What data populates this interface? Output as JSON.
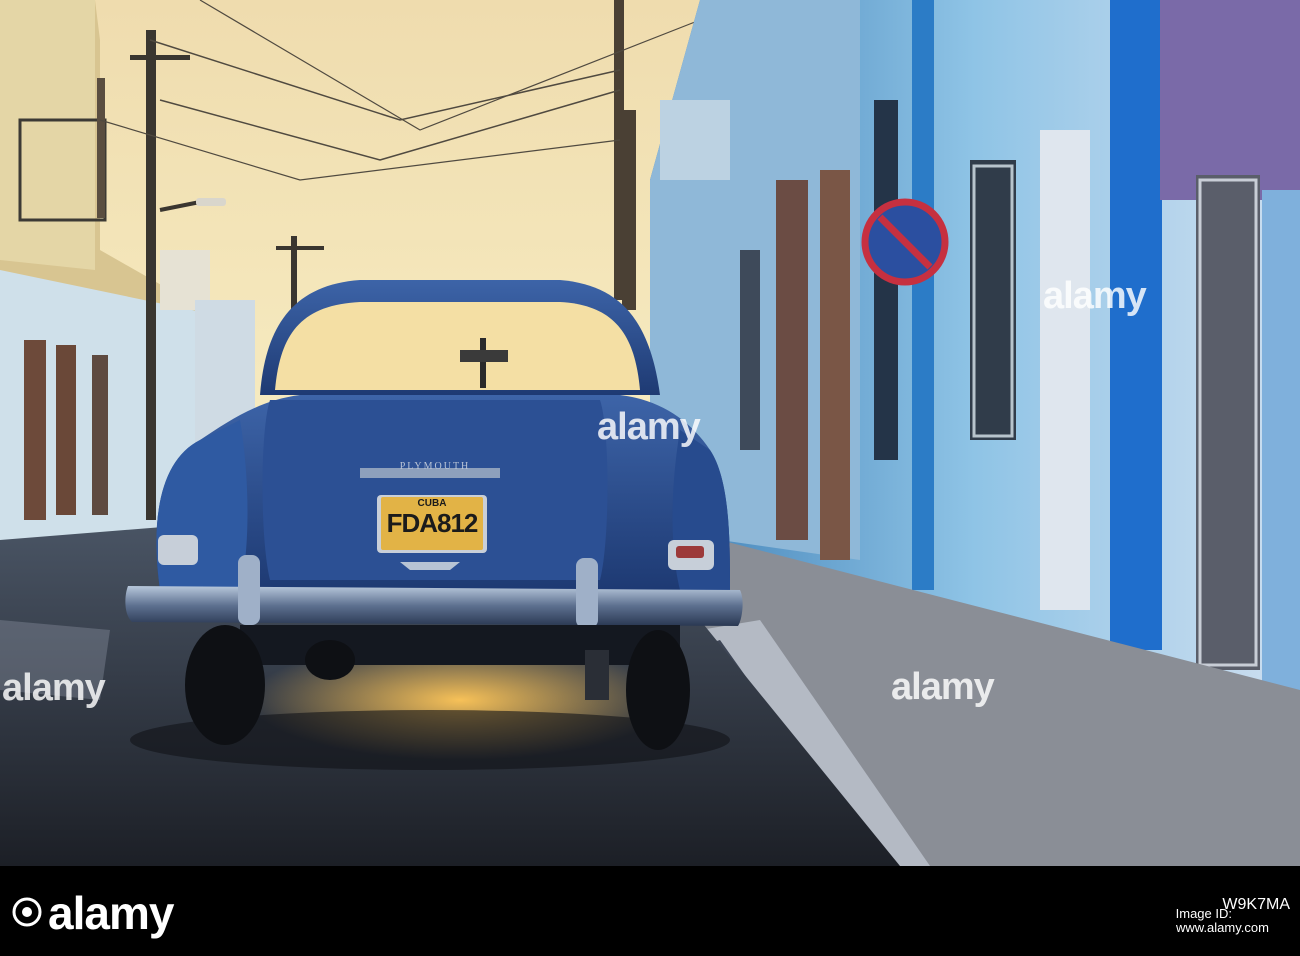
{
  "photo": {
    "description_colors": {
      "sky_top": "#f2e4b8",
      "sky_glow": "#fbf0c0",
      "car_body": "#2a4f93",
      "building_blue": "#4fa6d9",
      "street": "#2a2e36"
    }
  },
  "car": {
    "badge": "PLYMOUTH",
    "plate_country": "CUBA",
    "plate_number": "FDA812"
  },
  "watermarks": {
    "left": "alamy",
    "center": "alamy",
    "top_right": "alamy",
    "bottom_right": "alamy"
  },
  "footer": {
    "logo": "alamy",
    "image_id_label": "Image ID:",
    "image_id": "W9K7MA",
    "url": "www.alamy.com"
  }
}
